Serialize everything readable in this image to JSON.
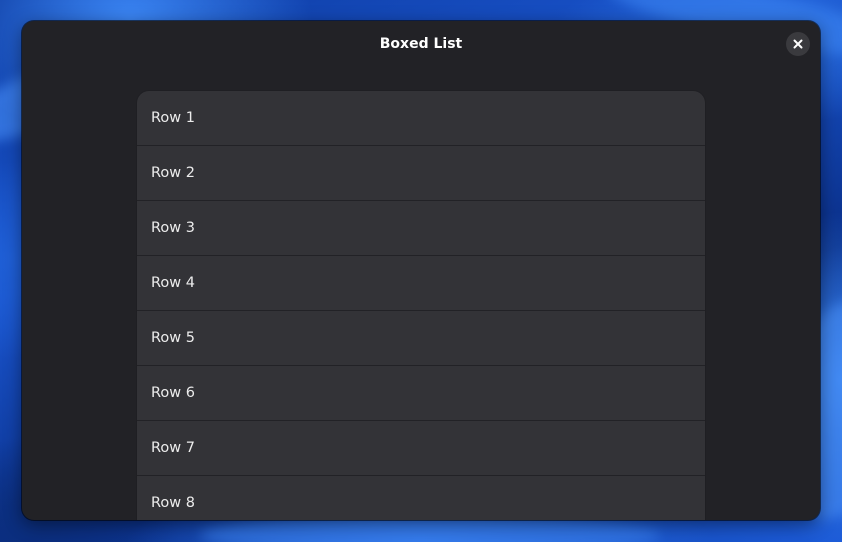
{
  "window": {
    "title": "Boxed List",
    "close_icon": "close-icon"
  },
  "list": {
    "rows": [
      {
        "label": "Row 1"
      },
      {
        "label": "Row 2"
      },
      {
        "label": "Row 3"
      },
      {
        "label": "Row 4"
      },
      {
        "label": "Row 5"
      },
      {
        "label": "Row 6"
      },
      {
        "label": "Row 7"
      },
      {
        "label": "Row 8"
      }
    ]
  },
  "colors": {
    "window_bg": "#222226",
    "row_bg": "#333337",
    "row_separator": "#222226",
    "text": "#ececec",
    "close_button_bg": "#3a3a3e",
    "desktop_accent": "#1a55cf"
  }
}
